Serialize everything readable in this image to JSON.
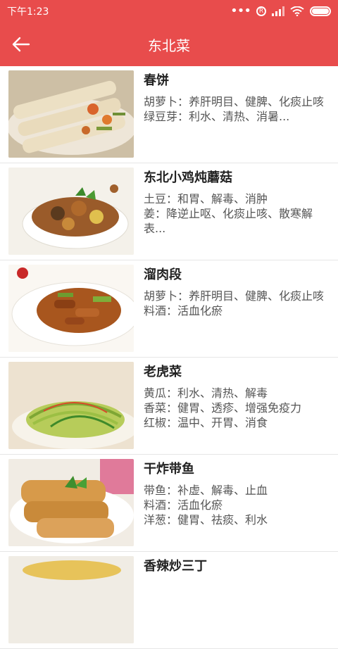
{
  "status": {
    "time": "下午1:23",
    "sim_label": "R",
    "battery_level": 1.0
  },
  "header": {
    "title": "东北菜",
    "back_icon": "arrow-left-icon"
  },
  "colors": {
    "accent": "#e84c4c"
  },
  "recipes": [
    {
      "name": "春饼",
      "desc": "胡萝卜：养肝明目、健脾、化痰止咳\n绿豆芽：利水、清热、消暑..."
    },
    {
      "name": "东北小鸡炖蘑菇",
      "desc": "土豆：和胃、解毒、消肿\n姜：降逆止呕、化痰止咳、散寒解表..."
    },
    {
      "name": "溜肉段",
      "desc": "胡萝卜：养肝明目、健脾、化痰止咳\n料酒：活血化瘀"
    },
    {
      "name": "老虎菜",
      "desc": "黄瓜：利水、清热、解毒\n香菜：健胃、透疹、增强免疫力\n红椒：温中、开胃、消食"
    },
    {
      "name": "干炸带鱼",
      "desc": "带鱼：补虚、解毒、止血\n料酒：活血化瘀\n洋葱：健胃、祛痰、利水"
    },
    {
      "name": "香辣炒三丁",
      "desc": ""
    }
  ]
}
